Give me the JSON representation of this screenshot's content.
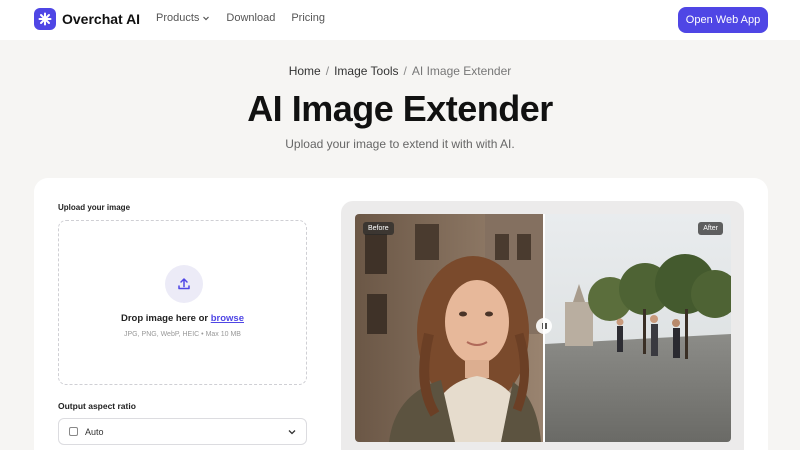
{
  "nav": {
    "brand": "Overchat AI",
    "links": [
      {
        "label": "Products",
        "has_dropdown": true
      },
      {
        "label": "Download",
        "has_dropdown": false
      },
      {
        "label": "Pricing",
        "has_dropdown": false
      }
    ],
    "cta": "Open Web App"
  },
  "breadcrumb": [
    "Home",
    "Image Tools",
    "AI Image Extender"
  ],
  "hero": {
    "title": "AI Image Extender",
    "subtitle": "Upload your image to extend it with with AI."
  },
  "upload": {
    "label": "Upload your image",
    "drop_text": "Drop image here or",
    "browse": "browse",
    "hint": "JPG, PNG, WebP, HEIC • Max 10 MB"
  },
  "ratio": {
    "label": "Output aspect ratio",
    "value": "Auto"
  },
  "preview": {
    "before_label": "Before",
    "after_label": "After"
  },
  "colors": {
    "brand": "#4f46e5",
    "background": "#f6f5f3",
    "card": "#ffffff"
  }
}
